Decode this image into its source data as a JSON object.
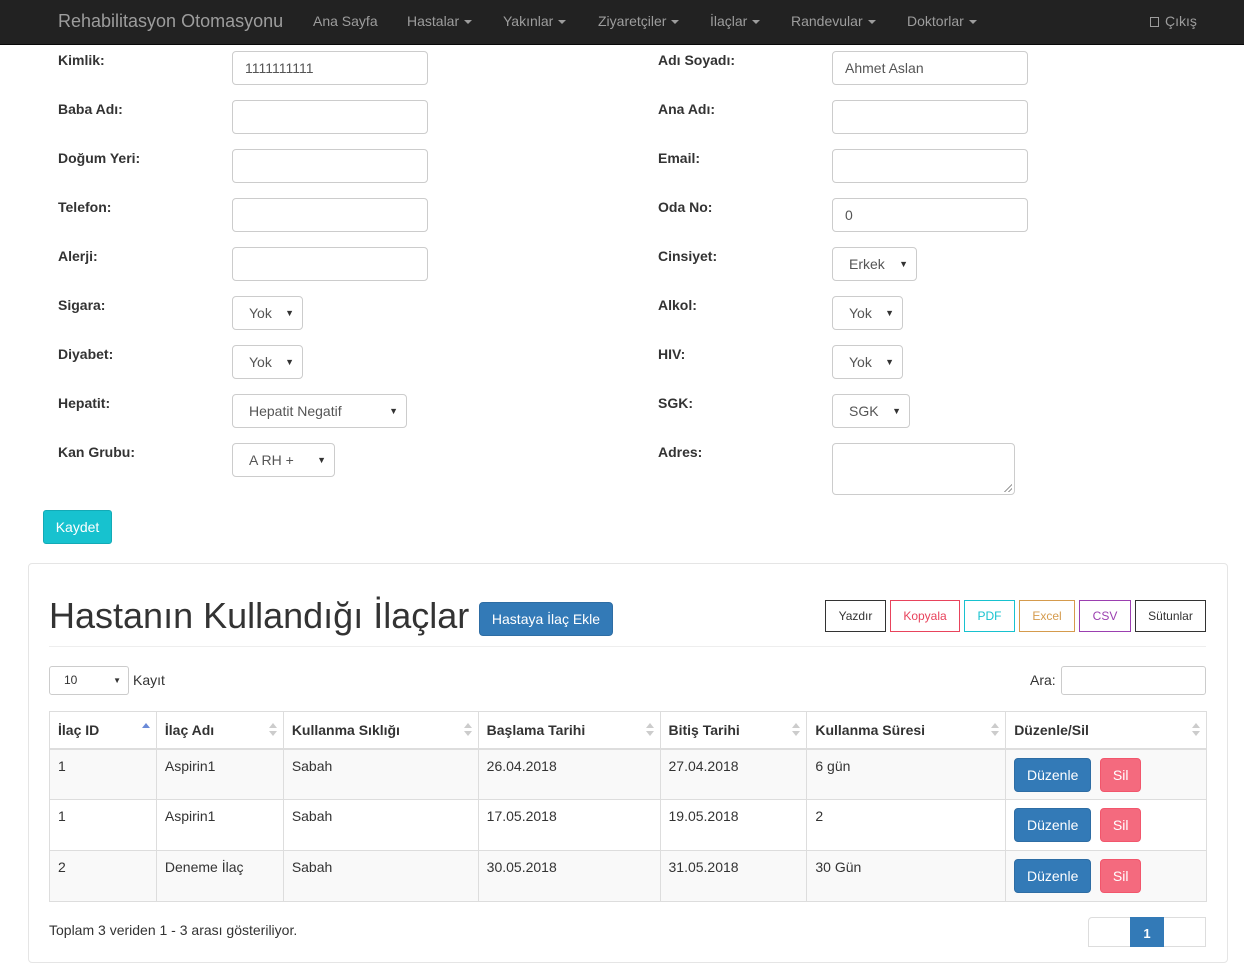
{
  "navbar": {
    "brand": "Rehabilitasyon Otomasyonu",
    "items": [
      {
        "label": "Ana Sayfa",
        "dropdown": false
      },
      {
        "label": "Hastalar",
        "dropdown": true
      },
      {
        "label": "Yakınlar",
        "dropdown": true
      },
      {
        "label": "Ziyaretçiler",
        "dropdown": true
      },
      {
        "label": "İlaçlar",
        "dropdown": true
      },
      {
        "label": "Randevular",
        "dropdown": true
      },
      {
        "label": "Doktorlar",
        "dropdown": true
      }
    ],
    "logout_label": "Çıkış"
  },
  "form": {
    "kimlik": {
      "label": "Kimlik:",
      "value": "1111111111"
    },
    "adi_soyadi": {
      "label": "Adı Soyadı:",
      "value": "Ahmet Aslan"
    },
    "baba_adi": {
      "label": "Baba Adı:",
      "value": ""
    },
    "ana_adi": {
      "label": "Ana Adı:",
      "value": ""
    },
    "dogum_yeri": {
      "label": "Doğum Yeri:",
      "value": ""
    },
    "email": {
      "label": "Email:",
      "value": ""
    },
    "telefon": {
      "label": "Telefon:",
      "value": ""
    },
    "oda_no": {
      "label": "Oda No:",
      "value": "0"
    },
    "alerji": {
      "label": "Alerji:",
      "value": ""
    },
    "cinsiyet": {
      "label": "Cinsiyet:",
      "value": "Erkek"
    },
    "sigara": {
      "label": "Sigara:",
      "value": "Yok"
    },
    "alkol": {
      "label": "Alkol:",
      "value": "Yok"
    },
    "diyabet": {
      "label": "Diyabet:",
      "value": "Yok"
    },
    "hiv": {
      "label": "HIV:",
      "value": "Yok"
    },
    "hepatit": {
      "label": "Hepatit:",
      "value": "Hepatit Negatif"
    },
    "sgk": {
      "label": "SGK:",
      "value": "SGK"
    },
    "kan_grubu": {
      "label": "Kan Grubu:",
      "value": "A RH +"
    },
    "adres": {
      "label": "Adres:",
      "value": ""
    },
    "save_label": "Kaydet"
  },
  "panel": {
    "title": "Hastanın Kullandığı İlaçlar",
    "add_button": "Hastaya İlaç Ekle",
    "export_buttons": [
      {
        "label": "Yazdır",
        "color": "#333333"
      },
      {
        "label": "Kopyala",
        "color": "#e8435c"
      },
      {
        "label": "PDF",
        "color": "#17c2cf"
      },
      {
        "label": "Excel",
        "color": "#d59b4d"
      },
      {
        "label": "CSV",
        "color": "#9b3fb0"
      },
      {
        "label": "Sütunlar",
        "color": "#333333"
      }
    ],
    "page_length": "10",
    "page_length_suffix": "Kayıt",
    "search_label": "Ara:",
    "search_value": "",
    "table": {
      "columns": [
        "İlaç ID",
        "İlaç Adı",
        "Kullanma Sıklığı",
        "Başlama Tarihi",
        "Bitiş Tarihi",
        "Kullanma Süresi",
        "Düzenle/Sil"
      ],
      "rows": [
        [
          "1",
          "Aspirin1",
          "Sabah",
          "26.04.2018",
          "27.04.2018",
          "6 gün"
        ],
        [
          "1",
          "Aspirin1",
          "Sabah",
          "17.05.2018",
          "19.05.2018",
          "2"
        ],
        [
          "2",
          "Deneme İlaç",
          "Sabah",
          "30.05.2018",
          "31.05.2018",
          "30 Gün"
        ]
      ],
      "edit_label": "Düzenle",
      "delete_label": "Sil"
    },
    "info": "Toplam 3 veriden 1 - 3 arası gösteriliyor.",
    "current_page": "1"
  },
  "colors": {
    "navbar": "#222222",
    "primary": "#337ab7",
    "save": "#17c2cf",
    "delete": "#f46a7e"
  }
}
